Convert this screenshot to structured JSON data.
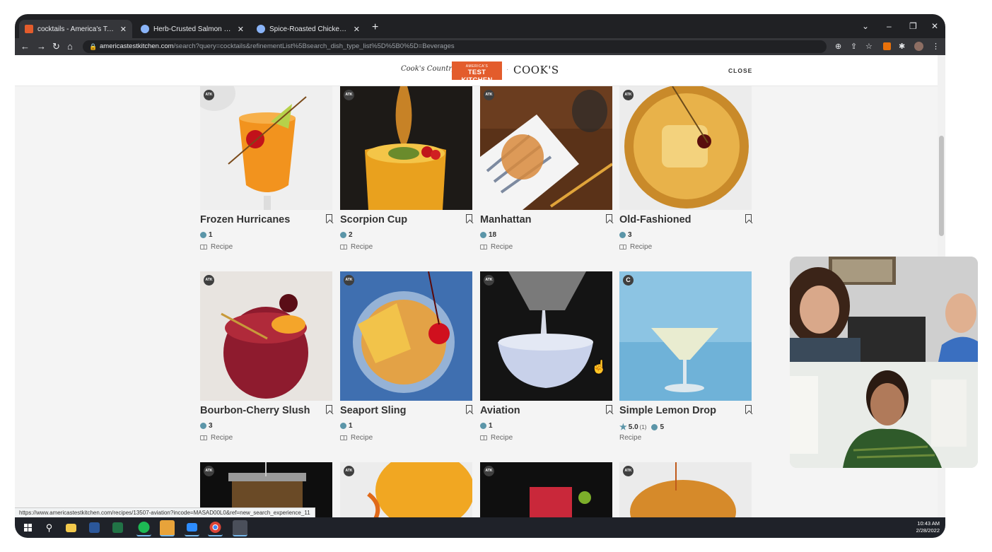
{
  "browser": {
    "tabs": [
      {
        "title": "cocktails - America's Test Kitchen",
        "active": true
      },
      {
        "title": "Herb-Crusted Salmon with Dilled",
        "active": false
      },
      {
        "title": "Spice-Roasted Chicken with Dill a",
        "active": false
      }
    ],
    "url_host": "americastestkitchen.com",
    "url_path": "/search?query=cocktails&refinementList%5Bsearch_dish_type_list%5D%5B0%5D=Beverages",
    "status_url": "https://www.americastestkitchen.com/recipes/13507-aviation?incode=MASAD00L0&ref=new_search_experience_11"
  },
  "site_header": {
    "cooks_country": "Cook's Country",
    "atk_top": "AMERICA'S",
    "atk_bottom": "TEST KITCHEN",
    "cooks": "COOK'S",
    "close_label": "CLOSE"
  },
  "recipes": [
    {
      "title": "Frozen Hurricanes",
      "badge": "ATK",
      "comments": "1",
      "type": "Recipe"
    },
    {
      "title": "Scorpion Cup",
      "badge": "ATK",
      "comments": "2",
      "type": "Recipe"
    },
    {
      "title": "Manhattan",
      "badge": "ATK",
      "comments": "18",
      "type": "Recipe"
    },
    {
      "title": "Old-Fashioned",
      "badge": "ATK",
      "comments": "3",
      "type": "Recipe"
    },
    {
      "title": "Bourbon-Cherry Slush",
      "badge": "ATK",
      "comments": "3",
      "type": "Recipe"
    },
    {
      "title": "Seaport Sling",
      "badge": "ATK",
      "comments": "1",
      "type": "Recipe"
    },
    {
      "title": "Aviation",
      "badge": "ATK",
      "comments": "1",
      "type": "Recipe"
    },
    {
      "title": "Simple Lemon Drop",
      "badge": "C",
      "rating": "5.0",
      "rating_count": "(1)",
      "comments": "5",
      "type": "Recipe"
    },
    {
      "badge": "ATK"
    },
    {
      "badge": "ATK"
    },
    {
      "badge": "ATK"
    },
    {
      "badge": "ATK"
    }
  ],
  "taskbar": {
    "time": "10:43 AM",
    "date": "2/28/2022"
  },
  "colors": {
    "atk_orange": "#e35c2c",
    "comment_bubble": "#5b95a8",
    "chrome_dark": "#202124"
  }
}
